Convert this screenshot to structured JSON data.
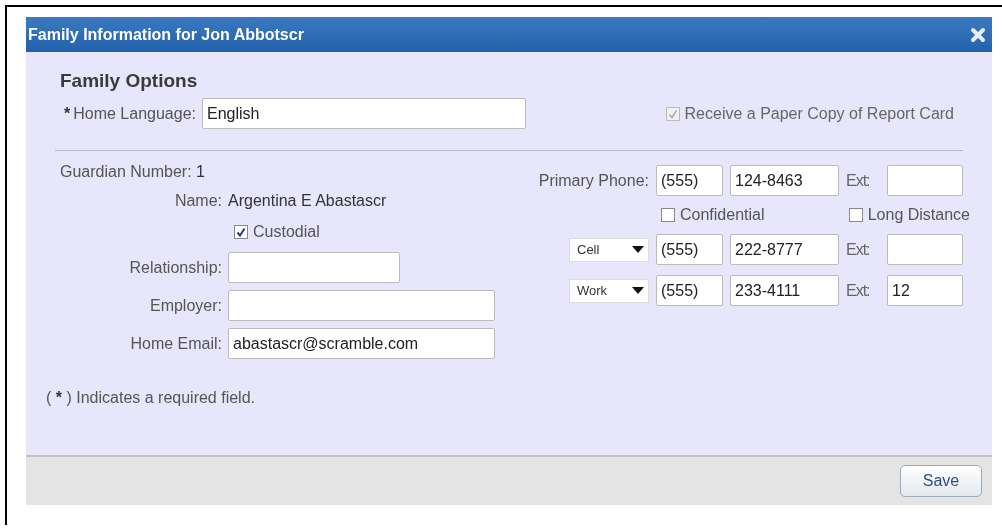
{
  "window": {
    "title": "Family Information for Jon Abbotscr"
  },
  "family_options": {
    "heading": "Family Options",
    "required_mark": "*",
    "home_language": {
      "label": "Home Language:",
      "value": "English"
    },
    "paper_copy": {
      "label": "Receive a Paper Copy of Report Card",
      "checked": true,
      "disabled": true
    }
  },
  "guardian": {
    "number_label": "Guardian Number:",
    "number": "1",
    "name_label": "Name:",
    "name": "Argentina E Abastascr",
    "custodial": {
      "label": "Custodial",
      "checked": true
    },
    "fields": [
      {
        "label": "Relationship:"
      },
      {
        "label": "Employer:"
      },
      {
        "label": "Home Email:",
        "value": "abastascr@scramble.com"
      }
    ]
  },
  "phones": {
    "primary": {
      "label": "Primary Phone:",
      "area": "(555)",
      "number": "124-8463",
      "ext_label": "Ext:"
    },
    "flags": [
      {
        "label": "Confidential",
        "checked": false
      },
      {
        "label": "Long Distance",
        "checked": false
      }
    ],
    "others": [
      {
        "type": "Cell",
        "area": "(555)",
        "number": "222-8777",
        "ext_label": "Ext:"
      },
      {
        "type": "Work",
        "area": "(555)",
        "number": "233-4111",
        "ext_label": "Ext:",
        "ext": "12"
      }
    ]
  },
  "footnote": {
    "open": "(",
    "mark": "*",
    "text": ") Indicates a required field."
  },
  "buttons": [
    {
      "label": "Save"
    }
  ]
}
